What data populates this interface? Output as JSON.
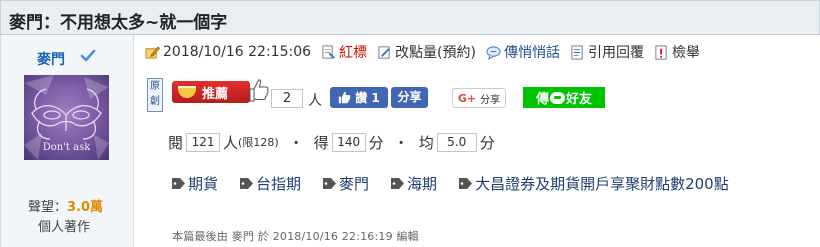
{
  "thread": {
    "title": "麥門：不用想太多~就一個字"
  },
  "author": {
    "name": "麥門",
    "avatar_caption": "Don't ask",
    "reputation_label": "聲望：",
    "reputation_value": "3.0萬",
    "works_label": "個人著作"
  },
  "toolbar": {
    "timestamp": "2018/10/16 22:15:06",
    "items": [
      {
        "label": "紅標",
        "icon": "red-flag-icon"
      },
      {
        "label": "改點量(預約)",
        "icon": "edit-icon"
      },
      {
        "label": "傳悄悄話",
        "icon": "whisper-icon"
      },
      {
        "label": "引用回覆",
        "icon": "quote-icon"
      },
      {
        "label": "檢舉",
        "icon": "report-icon"
      }
    ]
  },
  "actions": {
    "original_badge": "原創",
    "recommend_label": "推薦",
    "recommend_count": "2",
    "recommend_unit": "人",
    "fb_like_label": "讚 1",
    "fb_share_label": "分享",
    "google_share_label": "分享",
    "line_share_prefix": "傳",
    "line_share_suffix": "好友"
  },
  "stats": {
    "views_label": "閱",
    "views_value": "121",
    "views_unit": "人",
    "views_limit": "(限128)",
    "score_label": "得",
    "score_value": "140",
    "score_unit": "分",
    "avg_label": "均",
    "avg_value": "5.0",
    "avg_unit": "分"
  },
  "tags": [
    "期貨",
    "台指期",
    "麥門",
    "海期",
    "大昌證券及期貨開戶享聚財點數200點"
  ],
  "edit_note": "本篇最後由 麥門 於 2018/10/16 22:16:19 編輯",
  "colors": {
    "accent": "#1f4e8f",
    "red": "#cc1100",
    "reputation": "#e08a00",
    "line": "#00c300",
    "facebook": "#4267b2"
  }
}
